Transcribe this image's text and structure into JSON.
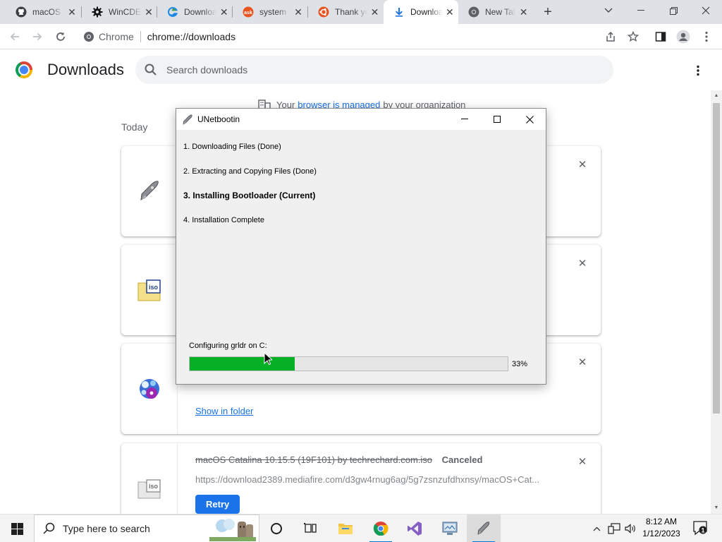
{
  "tabs": [
    {
      "title": "macOS",
      "icon": "github-icon",
      "active": false
    },
    {
      "title": "WinCDEmu",
      "icon": "gear-icon",
      "active": false
    },
    {
      "title": "Downloads",
      "icon": "edge-icon",
      "active": false
    },
    {
      "title": "system",
      "icon": "askubuntu-icon",
      "active": false
    },
    {
      "title": "Thank you",
      "icon": "ubuntu-icon",
      "active": false
    },
    {
      "title": "Downloads",
      "icon": "download-icon",
      "active": true
    },
    {
      "title": "New Tab",
      "icon": "chrome-icon",
      "active": false
    }
  ],
  "toolbar": {
    "chip": "Chrome",
    "url": "chrome://downloads"
  },
  "downloads": {
    "title": "Downloads",
    "search_placeholder": "Search downloads",
    "managed_prefix": "Your",
    "managed_link": "browser is managed",
    "managed_suffix": "by your organization",
    "date_header": "Today",
    "show_in_folder": "Show in folder",
    "item4": {
      "filename": "macOS Catalina 10.15.5 (19F101) by techrechard.com.iso",
      "status": "Canceled",
      "url": "https://download2389.mediafire.com/d3gw4rnug6ag/5g7zsnzufdhxnsy/macOS+Cat...",
      "retry": "Retry"
    }
  },
  "dialog": {
    "title": "UNetbootin",
    "steps": [
      "1. Downloading Files (Done)",
      "2. Extracting and Copying Files (Done)",
      "3. Installing Bootloader (Current)",
      "4. Installation Complete"
    ],
    "status": "Configuring grldr on C:",
    "progress": 0.33,
    "progress_label": "33%"
  },
  "taskbar": {
    "search_placeholder": "Type here to search",
    "time": "8:12 AM",
    "date": "1/12/2023"
  },
  "colors": {
    "accent": "#1a73e8",
    "progress_fill": "#06b025",
    "tabstrip_bg": "#dee1e6",
    "taskbar_bg": "#f3f3f3"
  }
}
